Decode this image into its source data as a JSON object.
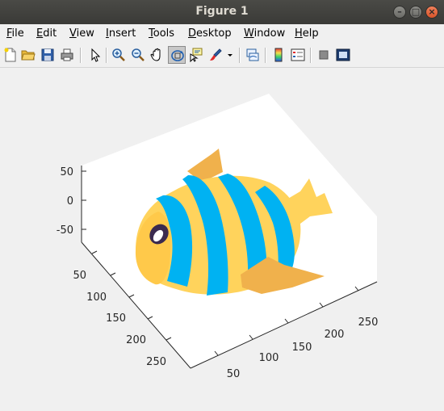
{
  "window": {
    "title": "Figure 1",
    "minimize_glyph": "–",
    "maximize_glyph": "□",
    "close_glyph": "×"
  },
  "menu": [
    {
      "first": "F",
      "rest": "ile"
    },
    {
      "first": "E",
      "rest": "dit"
    },
    {
      "first": "V",
      "rest": "iew"
    },
    {
      "first": "I",
      "rest": "nsert"
    },
    {
      "first": "T",
      "rest": "ools"
    },
    {
      "first": "D",
      "rest": "esktop"
    },
    {
      "first": "W",
      "rest": "indow"
    },
    {
      "first": "H",
      "rest": "elp"
    }
  ],
  "toolbar_icons": [
    "new-figure-icon",
    "open-file-icon",
    "save-icon",
    "print-icon",
    "edit-plot-arrow-icon",
    "zoom-in-icon",
    "zoom-out-icon",
    "pan-hand-icon",
    "rotate-3d-icon",
    "data-cursor-icon",
    "brush-icon",
    "brush-dropdown-icon",
    "link-plot-icon",
    "colorbar-icon",
    "legend-icon",
    "hide-plot-tools-icon",
    "show-plot-tools-icon"
  ],
  "plot": {
    "z_ticks": [
      "50",
      "0",
      "-50"
    ],
    "y_ticks": [
      "50",
      "100",
      "150",
      "200",
      "250"
    ],
    "x_ticks": [
      "50",
      "100",
      "150",
      "200",
      "250"
    ],
    "colors": {
      "yellow": "#ffd35c",
      "blue": "#00b2f2",
      "orange": "#f0b14c",
      "eye": "#3b2a4f",
      "background": "#ffffff"
    }
  }
}
